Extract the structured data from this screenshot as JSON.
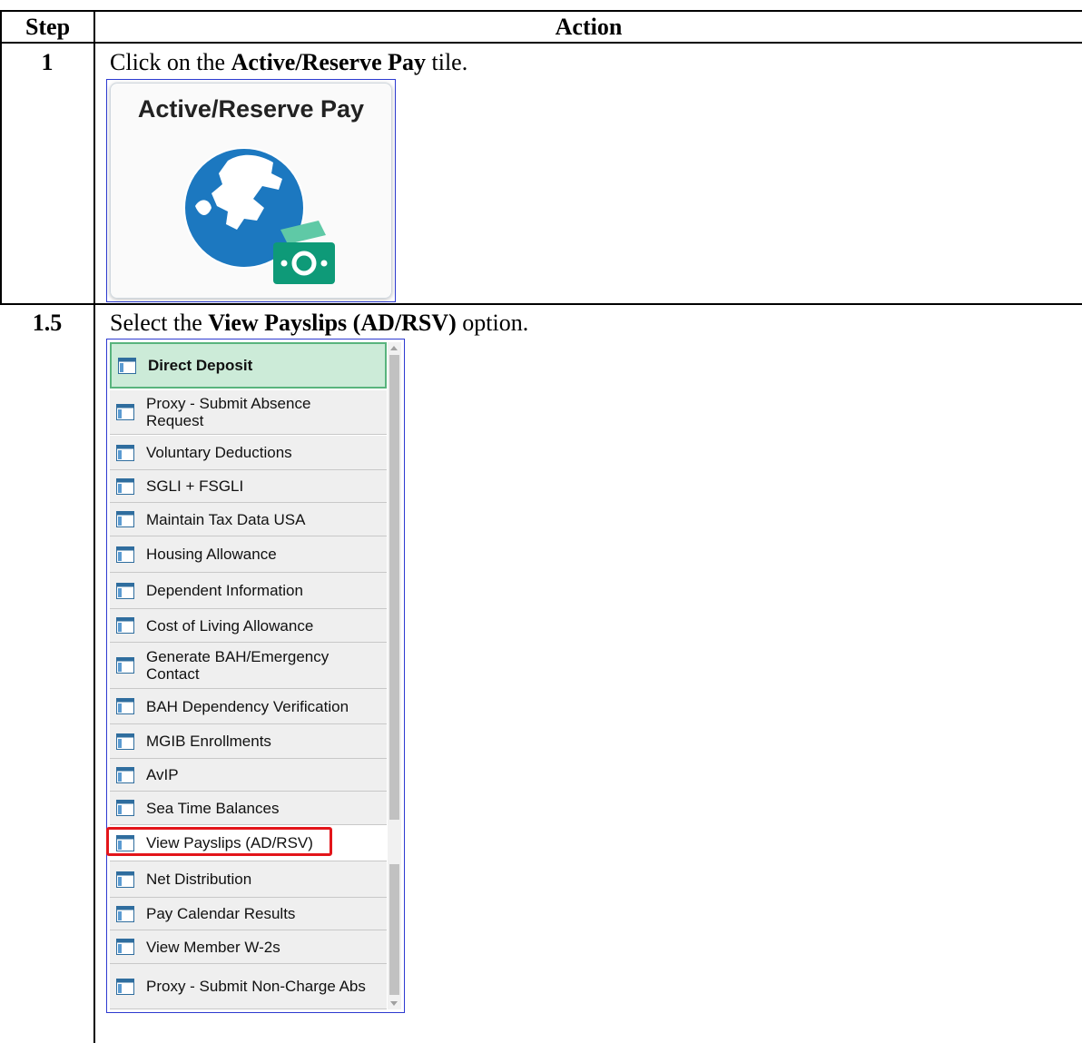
{
  "table": {
    "header_step": "Step",
    "header_action": "Action"
  },
  "rows": [
    {
      "step": "1",
      "text_before": "Click on the ",
      "text_bold": "Active/Reserve Pay",
      "text_after": " tile."
    },
    {
      "step": "1.5",
      "text_before": "Select the ",
      "text_bold": "View Payslips (AD/RSV)",
      "text_after": " option."
    }
  ],
  "tile": {
    "title": "Active/Reserve Pay",
    "icon": "globe-money-icon",
    "globe_color": "#1c78c0",
    "money_color": "#0e9a78"
  },
  "menu": {
    "item_icon": "page-list-icon",
    "selected_color": "#ccebd8",
    "highlight_box_color": "#e3151a",
    "items": [
      {
        "label": "Direct Deposit"
      },
      {
        "label": "Proxy - Submit Absence Request"
      },
      {
        "label": "Voluntary Deductions"
      },
      {
        "label": "SGLI + FSGLI"
      },
      {
        "label": "Maintain Tax Data USA"
      },
      {
        "label": "Housing Allowance"
      },
      {
        "label": "Dependent Information"
      },
      {
        "label": "Cost of Living Allowance"
      },
      {
        "label": "Generate BAH/Emergency Contact"
      },
      {
        "label": "BAH Dependency Verification"
      },
      {
        "label": "MGIB Enrollments"
      },
      {
        "label": "AvIP"
      },
      {
        "label": "Sea Time Balances"
      },
      {
        "label": "View Payslips (AD/RSV)"
      },
      {
        "label": "Net Distribution"
      },
      {
        "label": "Pay Calendar Results"
      },
      {
        "label": "View Member W-2s"
      },
      {
        "label": "Proxy - Submit Non-Charge Abs"
      }
    ]
  }
}
